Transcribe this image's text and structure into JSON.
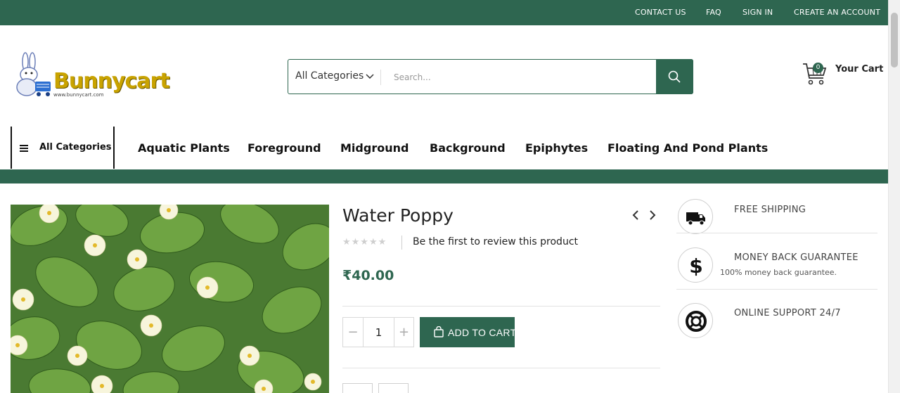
{
  "topbar": {
    "links": [
      "CONTACT US",
      "FAQ",
      "SIGN IN",
      "CREATE AN ACCOUNT"
    ]
  },
  "logo": {
    "name": "Bunnycart",
    "url": "www.bunnycart.com"
  },
  "search": {
    "category": "All Categories",
    "placeholder": "Search..."
  },
  "cart": {
    "count": "0",
    "label": "Your Cart"
  },
  "nav": {
    "all_categories": "All Categories",
    "items": [
      "Aquatic Plants",
      "Foreground",
      "Midground",
      "Background",
      "Epiphytes",
      "Floating And Pond Plants"
    ]
  },
  "product": {
    "title": "Water Poppy",
    "stars": "★★★★★",
    "review_text": "Be the first to review this product",
    "price": "₹40.00",
    "quantity": "1",
    "minus": "−",
    "plus": "+",
    "add_to_cart": "ADD TO CART"
  },
  "features": [
    {
      "title": "FREE SHIPPING",
      "subtitle": ""
    },
    {
      "title": "MONEY BACK GUARANTEE",
      "subtitle": "100% money back guarantee."
    },
    {
      "title": "ONLINE SUPPORT 24/7",
      "subtitle": ""
    }
  ],
  "colors": {
    "brand_green": "#2e6650",
    "logo_gold": "#c9a300"
  }
}
